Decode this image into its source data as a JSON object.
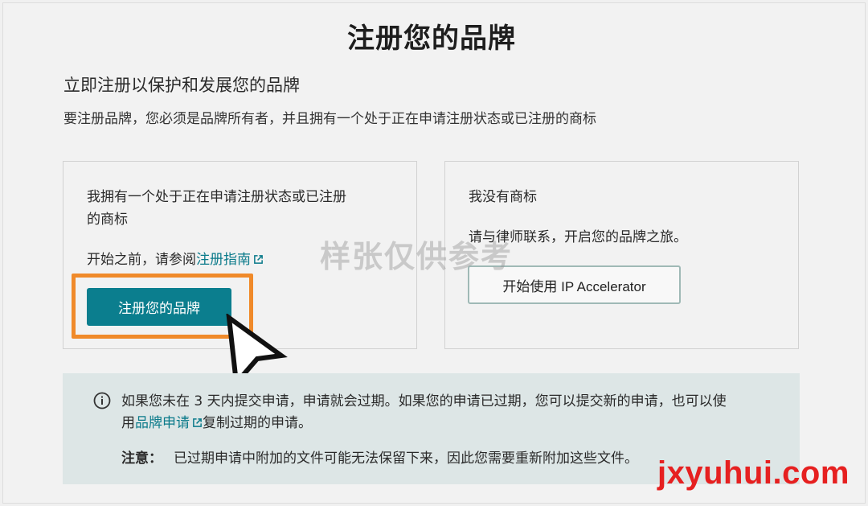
{
  "page": {
    "title": "注册您的品牌",
    "subtitle": "立即注册以保护和发展您的品牌",
    "description": "要注册品牌，您必须是品牌所有者，并且拥有一个处于正在申请注册状态或已注册的商标"
  },
  "left_card": {
    "heading_line1": "我拥有一个处于正在申请注册状态或已注册",
    "heading_line2": "的商标",
    "guide_prefix": "开始之前，请参阅",
    "guide_link": "注册指南",
    "button_label": "注册您的品牌"
  },
  "right_card": {
    "heading": "我没有商标",
    "text": "请与律师联系，开启您的品牌之旅。",
    "button_label": "开始使用 IP Accelerator"
  },
  "alert": {
    "line1": "如果您未在 3 天内提交申请，申请就会过期。如果您的申请已过期，您可以提交新的申请，也可以使",
    "line2_prefix": "用",
    "line2_link": "品牌申请",
    "line2_suffix": "复制过期的申请。",
    "note_label": "注意：",
    "note_text": "已过期申请中附加的文件可能无法保留下来，因此您需要重新附加这些文件。"
  },
  "overlays": {
    "watermark": "样张仅供参考",
    "site": "jxyuhui.com"
  },
  "colors": {
    "primary": "#0b7e8e",
    "highlight": "#f08a2a",
    "alert_bg": "#dde6e6",
    "site_mark": "#e62020"
  },
  "icons": [
    "external-link-icon",
    "info-icon",
    "mouse-cursor-icon"
  ]
}
